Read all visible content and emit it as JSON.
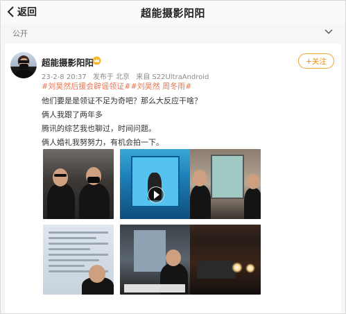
{
  "nav": {
    "back_label": "返回",
    "title": "超能摄影阳阳"
  },
  "visibility": {
    "label": "公开"
  },
  "post": {
    "author": "超能摄影阳阳",
    "meta": {
      "date": "23-2-8 20:37",
      "location": "发布于 北京",
      "source": "来自 S22UltraAndroid"
    },
    "follow_label": "+关注",
    "tags": [
      "#刘昊然后援会辟谣领证#",
      "#刘昊然 周冬雨#"
    ],
    "lines": [
      "他们要是是领证不足为奇吧？那么大反应干啥？",
      "俩人我跟了两年多",
      "腾讯的综艺我也聊过，时间问题。",
      "俩人婚礼我努努力，有机会拍一下。"
    ]
  },
  "icons": {
    "back": "chevron-left-icon",
    "visibility": "chevron-down-icon",
    "vip": "vip-crown-icon",
    "play": "play-icon"
  },
  "colors": {
    "accent_orange": "#f08a00",
    "tag_orange": "#eb7350",
    "background": "#f6f6f6",
    "card": "#ffffff"
  }
}
